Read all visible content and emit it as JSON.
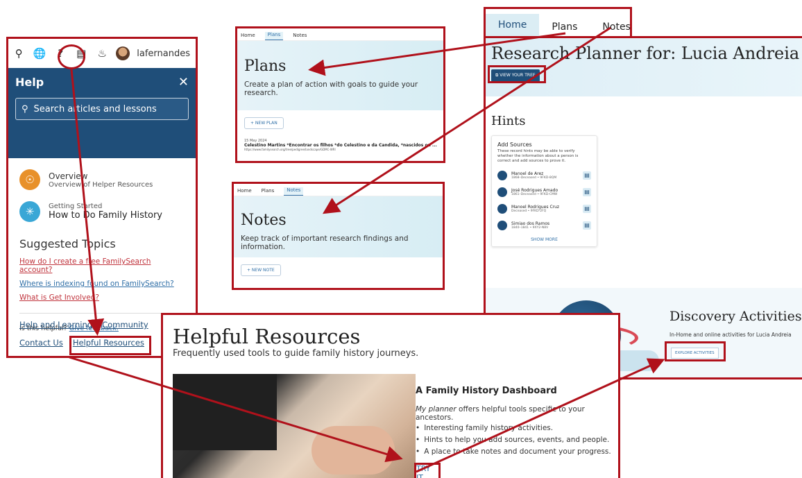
{
  "help": {
    "username": "lafernandes",
    "title": "Help",
    "close_glyph": "✕",
    "search_placeholder": "Search articles and lessons",
    "items": [
      {
        "title": "Overview",
        "subtitle": "Overview of Helper Resources",
        "icon": "compass-icon",
        "color": "#e8912a"
      },
      {
        "title": "Getting Started",
        "subtitle": "How to Do Family History",
        "icon": "lightbulb-icon",
        "color": "#3aa7d6"
      }
    ],
    "suggested_title": "Suggested Topics",
    "suggested": [
      {
        "label": "How do I create a free FamilySearch account?",
        "color": "#c0333c"
      },
      {
        "label": "Where is indexing found on FamilySearch?",
        "color": "#2e6ea6"
      },
      {
        "label": "What is Get Involved?",
        "color": "#c0333c"
      }
    ],
    "helpful_question": "Is this helpful?",
    "feedback_link": "Give feedback.",
    "footer": {
      "help_learning": "Help and Learning",
      "community": "Community",
      "contact": "Contact Us",
      "helpful_resources": "Helpful Resources"
    }
  },
  "plans": {
    "tabs": [
      "Home",
      "Plans",
      "Notes"
    ],
    "title": "Plans",
    "description": "Create a plan of action with goals to guide your research.",
    "new_button": "+ NEW PLAN",
    "entry_date": "15 May 2024",
    "entry_title": "Celestino Martins *Encontrar os filhos *do Celestino e da Candida, *nascidos ou ...",
    "entry_url": "https://www.familysearch.org/tree/pedigree/landscape/GDMC-WRI"
  },
  "notes": {
    "tabs": [
      "Home",
      "Plans",
      "Notes"
    ],
    "title": "Notes",
    "description": "Keep track of important research findings and information.",
    "new_button": "+ NEW NOTE"
  },
  "planner": {
    "tabs": [
      "Home",
      "Plans",
      "Notes"
    ],
    "title": "Research Planner for: Lucia Andreia",
    "view_tree": "VIEW YOUR TREE",
    "hints_title": "Hints",
    "card_title": "Add Sources",
    "card_desc": "These record hints may be able to verify whether the information about a person is correct and add sources to prove it.",
    "people": [
      {
        "name": "Manoel de Arez",
        "sub": "1868–Deceased • 9FKD-8QM"
      },
      {
        "name": "José Rodrigues Amado",
        "sub": "1861–Deceased • 9FKD-CMW"
      },
      {
        "name": "Manoel Rodrigues Cruz",
        "sub": "Deceased • 9FKD-2FQ"
      },
      {
        "name": "Simiao dos Ramos",
        "sub": "1840–1841 • 9XY2-N8V"
      }
    ],
    "show_more": "SHOW MORE",
    "discovery_title": "Discovery Activities",
    "discovery_sub": "In-Home and online activities for Lucia Andreia",
    "explore": "EXPLORE ACTIVITIES"
  },
  "resources": {
    "title": "Helpful Resources",
    "subtitle": "Frequently used tools to guide family history journeys.",
    "dash_title": "A Family History Dashboard",
    "dash_intro_em": "My planner",
    "dash_intro_rest": " offers helpful tools specific to your ancestors.",
    "bullets": [
      "Interesting family history activities.",
      "Hints to help you add sources, events, and people.",
      "A place to take notes and document your progress."
    ],
    "try_it": "TRY IT"
  },
  "colors": {
    "accent_red": "#b0111b",
    "brand_blue": "#1f4e79"
  }
}
